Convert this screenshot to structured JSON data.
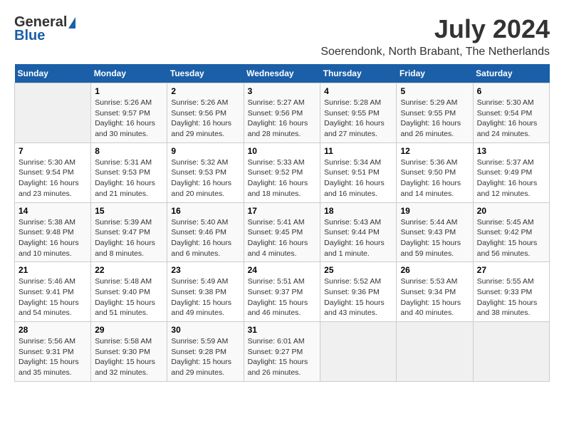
{
  "header": {
    "logo_line1": "General",
    "logo_line2": "Blue",
    "main_title": "July 2024",
    "subtitle": "Soerendonk, North Brabant, The Netherlands"
  },
  "calendar": {
    "days_of_week": [
      "Sunday",
      "Monday",
      "Tuesday",
      "Wednesday",
      "Thursday",
      "Friday",
      "Saturday"
    ],
    "weeks": [
      [
        {
          "num": "",
          "info": ""
        },
        {
          "num": "1",
          "info": "Sunrise: 5:26 AM\nSunset: 9:57 PM\nDaylight: 16 hours\nand 30 minutes."
        },
        {
          "num": "2",
          "info": "Sunrise: 5:26 AM\nSunset: 9:56 PM\nDaylight: 16 hours\nand 29 minutes."
        },
        {
          "num": "3",
          "info": "Sunrise: 5:27 AM\nSunset: 9:56 PM\nDaylight: 16 hours\nand 28 minutes."
        },
        {
          "num": "4",
          "info": "Sunrise: 5:28 AM\nSunset: 9:55 PM\nDaylight: 16 hours\nand 27 minutes."
        },
        {
          "num": "5",
          "info": "Sunrise: 5:29 AM\nSunset: 9:55 PM\nDaylight: 16 hours\nand 26 minutes."
        },
        {
          "num": "6",
          "info": "Sunrise: 5:30 AM\nSunset: 9:54 PM\nDaylight: 16 hours\nand 24 minutes."
        }
      ],
      [
        {
          "num": "7",
          "info": "Sunrise: 5:30 AM\nSunset: 9:54 PM\nDaylight: 16 hours\nand 23 minutes."
        },
        {
          "num": "8",
          "info": "Sunrise: 5:31 AM\nSunset: 9:53 PM\nDaylight: 16 hours\nand 21 minutes."
        },
        {
          "num": "9",
          "info": "Sunrise: 5:32 AM\nSunset: 9:53 PM\nDaylight: 16 hours\nand 20 minutes."
        },
        {
          "num": "10",
          "info": "Sunrise: 5:33 AM\nSunset: 9:52 PM\nDaylight: 16 hours\nand 18 minutes."
        },
        {
          "num": "11",
          "info": "Sunrise: 5:34 AM\nSunset: 9:51 PM\nDaylight: 16 hours\nand 16 minutes."
        },
        {
          "num": "12",
          "info": "Sunrise: 5:36 AM\nSunset: 9:50 PM\nDaylight: 16 hours\nand 14 minutes."
        },
        {
          "num": "13",
          "info": "Sunrise: 5:37 AM\nSunset: 9:49 PM\nDaylight: 16 hours\nand 12 minutes."
        }
      ],
      [
        {
          "num": "14",
          "info": "Sunrise: 5:38 AM\nSunset: 9:48 PM\nDaylight: 16 hours\nand 10 minutes."
        },
        {
          "num": "15",
          "info": "Sunrise: 5:39 AM\nSunset: 9:47 PM\nDaylight: 16 hours\nand 8 minutes."
        },
        {
          "num": "16",
          "info": "Sunrise: 5:40 AM\nSunset: 9:46 PM\nDaylight: 16 hours\nand 6 minutes."
        },
        {
          "num": "17",
          "info": "Sunrise: 5:41 AM\nSunset: 9:45 PM\nDaylight: 16 hours\nand 4 minutes."
        },
        {
          "num": "18",
          "info": "Sunrise: 5:43 AM\nSunset: 9:44 PM\nDaylight: 16 hours\nand 1 minute."
        },
        {
          "num": "19",
          "info": "Sunrise: 5:44 AM\nSunset: 9:43 PM\nDaylight: 15 hours\nand 59 minutes."
        },
        {
          "num": "20",
          "info": "Sunrise: 5:45 AM\nSunset: 9:42 PM\nDaylight: 15 hours\nand 56 minutes."
        }
      ],
      [
        {
          "num": "21",
          "info": "Sunrise: 5:46 AM\nSunset: 9:41 PM\nDaylight: 15 hours\nand 54 minutes."
        },
        {
          "num": "22",
          "info": "Sunrise: 5:48 AM\nSunset: 9:40 PM\nDaylight: 15 hours\nand 51 minutes."
        },
        {
          "num": "23",
          "info": "Sunrise: 5:49 AM\nSunset: 9:38 PM\nDaylight: 15 hours\nand 49 minutes."
        },
        {
          "num": "24",
          "info": "Sunrise: 5:51 AM\nSunset: 9:37 PM\nDaylight: 15 hours\nand 46 minutes."
        },
        {
          "num": "25",
          "info": "Sunrise: 5:52 AM\nSunset: 9:36 PM\nDaylight: 15 hours\nand 43 minutes."
        },
        {
          "num": "26",
          "info": "Sunrise: 5:53 AM\nSunset: 9:34 PM\nDaylight: 15 hours\nand 40 minutes."
        },
        {
          "num": "27",
          "info": "Sunrise: 5:55 AM\nSunset: 9:33 PM\nDaylight: 15 hours\nand 38 minutes."
        }
      ],
      [
        {
          "num": "28",
          "info": "Sunrise: 5:56 AM\nSunset: 9:31 PM\nDaylight: 15 hours\nand 35 minutes."
        },
        {
          "num": "29",
          "info": "Sunrise: 5:58 AM\nSunset: 9:30 PM\nDaylight: 15 hours\nand 32 minutes."
        },
        {
          "num": "30",
          "info": "Sunrise: 5:59 AM\nSunset: 9:28 PM\nDaylight: 15 hours\nand 29 minutes."
        },
        {
          "num": "31",
          "info": "Sunrise: 6:01 AM\nSunset: 9:27 PM\nDaylight: 15 hours\nand 26 minutes."
        },
        {
          "num": "",
          "info": ""
        },
        {
          "num": "",
          "info": ""
        },
        {
          "num": "",
          "info": ""
        }
      ]
    ]
  }
}
